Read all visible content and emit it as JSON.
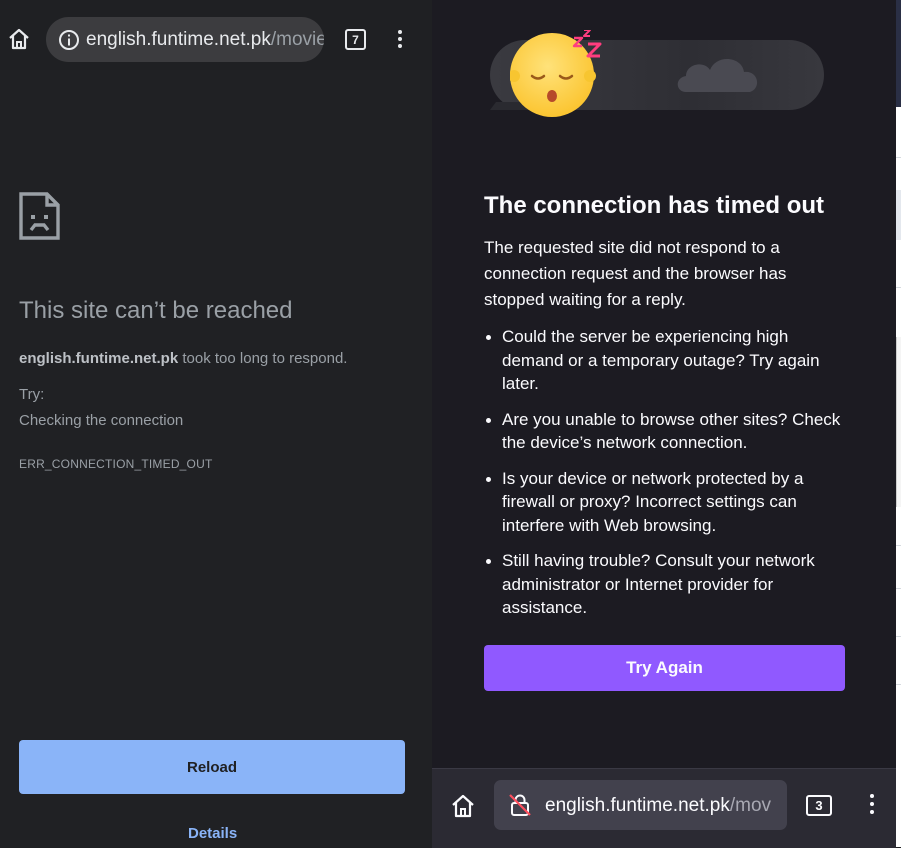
{
  "left_browser": {
    "url_domain": "english.funtime.net.pk",
    "url_path": "/movie",
    "tab_count": "7",
    "error_page": {
      "title": "This site can’t be reached",
      "host": "english.funtime.net.pk",
      "message": " took too long to respond.",
      "try_label": "Try:",
      "suggestion": "Checking the connection",
      "error_code": "ERR_CONNECTION_TIMED_OUT",
      "reload_label": "Reload",
      "details_label": "Details"
    }
  },
  "right_browser": {
    "title": "The connection has timed out",
    "intro": "The requested site did not respond to a connection request and the browser has stopped waiting for a reply.",
    "suggestions": [
      "Could the server be experiencing high demand or a temporary outage? Try again later.",
      "Are you unable to browse other sites? Check the device’s network connection.",
      "Is your device or network protected by a firewall or proxy? Incorrect settings can interfere with Web browsing.",
      "Still having trouble? Consult your network administrator or Internet provider for assistance."
    ],
    "try_again_label": "Try Again",
    "url_domain": "english.funtime.net.pk",
    "url_path": "/mov",
    "tab_count": "3",
    "colors": {
      "accent": "#9059ff",
      "background": "#1c1b22"
    }
  },
  "colors": {
    "chrome_accent": "#8ab4f8",
    "chrome_background": "#202124"
  }
}
